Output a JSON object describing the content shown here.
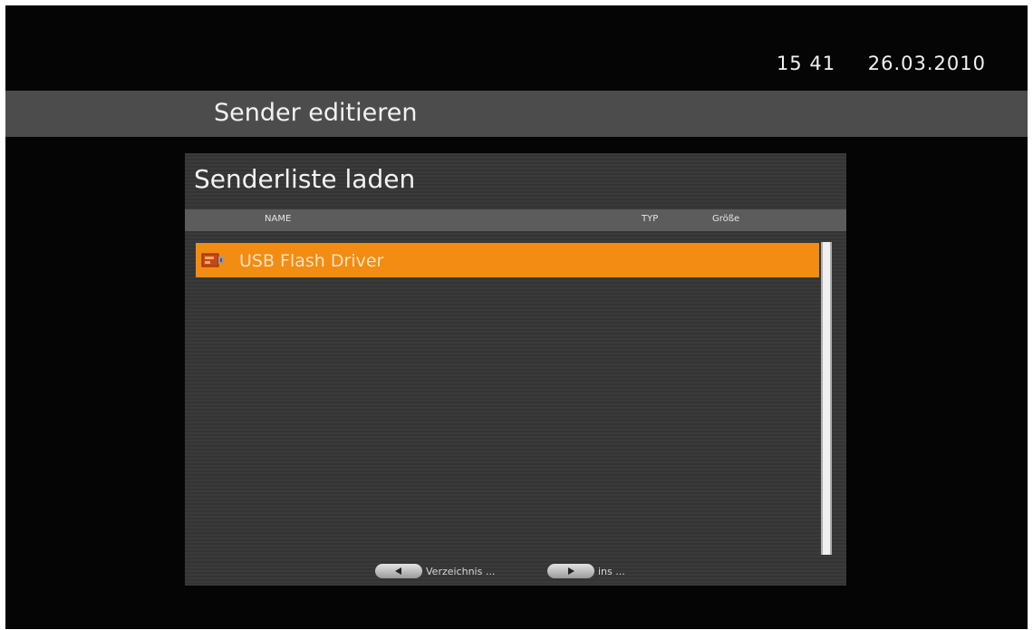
{
  "clock": {
    "time": "15 41",
    "date": "26.03.2010"
  },
  "header": {
    "title": "Sender editieren"
  },
  "dialog": {
    "title": "Senderliste laden",
    "columns": {
      "name": "NAME",
      "type": "TYP",
      "size": "Größe"
    },
    "rows": [
      {
        "label": "USB Flash Driver",
        "icon": "usb-drive-icon",
        "selected": true
      }
    ],
    "footer": {
      "left_hint": "Verzeichnis ...",
      "right_hint": "ins ..."
    }
  },
  "colors": {
    "selection": "#f28c12",
    "title_bar": "#4c4c4c",
    "panel": "#3a3a3a",
    "background": "#050505"
  }
}
